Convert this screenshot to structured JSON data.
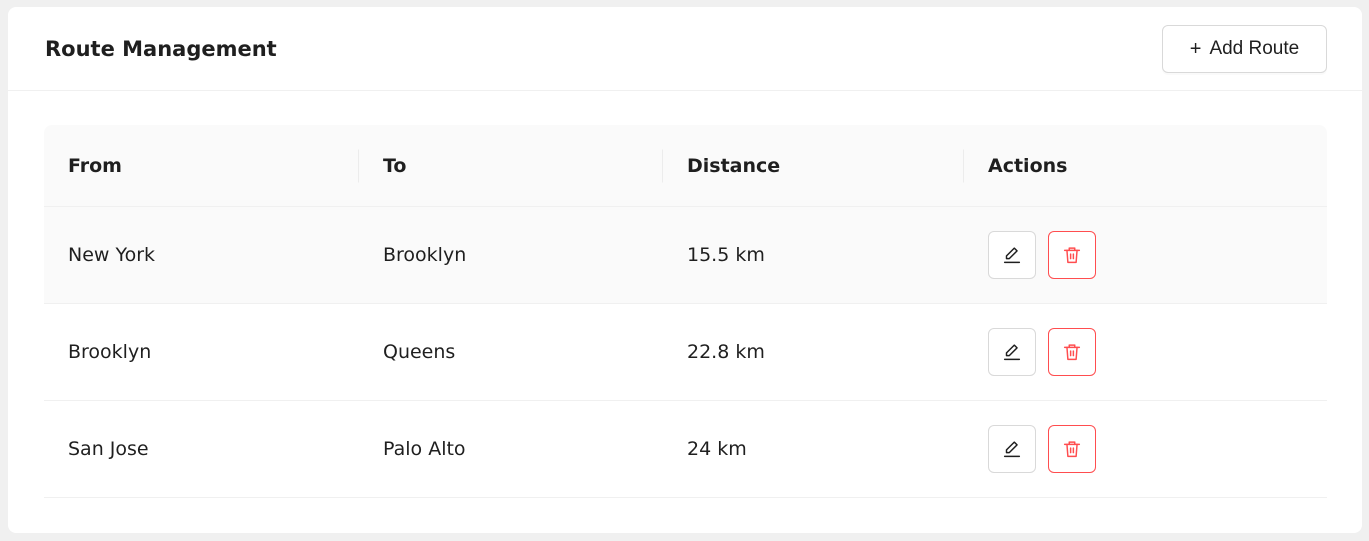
{
  "header": {
    "title": "Route Management",
    "add_button": {
      "icon": "+",
      "label": "Add Route"
    }
  },
  "table": {
    "columns": [
      "From",
      "To",
      "Distance",
      "Actions"
    ],
    "rows": [
      {
        "from": "New York",
        "to": "Brooklyn",
        "distance": "15.5 km"
      },
      {
        "from": "Brooklyn",
        "to": "Queens",
        "distance": "22.8 km"
      },
      {
        "from": "San Jose",
        "to": "Palo Alto",
        "distance": "24 km"
      }
    ]
  },
  "icons": {
    "edit": "edit-icon",
    "delete": "trash-icon"
  },
  "colors": {
    "danger": "#ff4d4f",
    "border": "#d9d9d9",
    "header_bg": "#fafafa",
    "page_bg": "#f0f0f0"
  }
}
